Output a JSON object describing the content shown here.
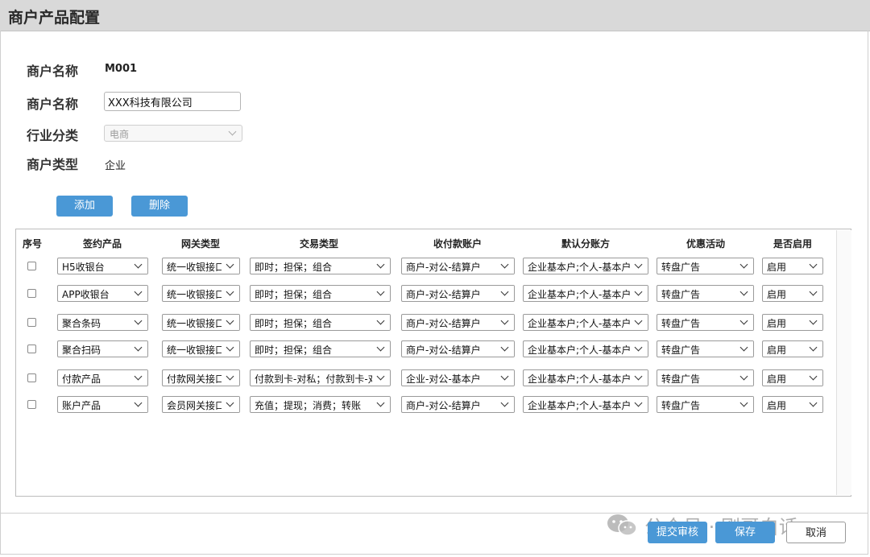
{
  "page_title": "商户产品配置",
  "form": {
    "merchant_id_label": "商户名称",
    "merchant_id_value": "M001",
    "merchant_name_label": "商户名称",
    "merchant_name_value": "XXX科技有限公司",
    "industry_label": "行业分类",
    "industry_value": "电商",
    "merchant_type_label": "商户类型",
    "merchant_type_value": "企业"
  },
  "toolbar": {
    "add_label": "添加",
    "delete_label": "删除"
  },
  "table": {
    "headers": [
      "序号",
      "签约产品",
      "网关类型",
      "交易类型",
      "收付款账户",
      "默认分账方",
      "优惠活动",
      "是否启用"
    ],
    "rows": [
      [
        "H5收银台",
        "统一收银接口",
        "即时；担保；组合",
        "商户-对公-结算户",
        "企业基本户;个人-基本户",
        "转盘广告",
        "启用"
      ],
      [
        "APP收银台",
        "统一收银接口",
        "即时；担保；组合",
        "商户-对公-结算户",
        "企业基本户;个人-基本户",
        "转盘广告",
        "启用"
      ],
      [
        "聚合条码",
        "统一收银接口",
        "即时；担保；组合",
        "商户-对公-结算户",
        "企业基本户;个人-基本户",
        "转盘广告",
        "启用"
      ],
      [
        "聚合扫码",
        "统一收银接口",
        "即时；担保；组合",
        "商户-对公-结算户",
        "企业基本户;个人-基本户",
        "转盘广告",
        "启用"
      ],
      [
        "付款产品",
        "付款网关接口",
        "付款到卡-对私；付款到卡-对公",
        "企业-对公-基本户",
        "企业基本户;个人-基本户",
        "转盘广告",
        "启用"
      ],
      [
        "账户产品",
        "会员网关接口",
        "充值；提现；消费；转账",
        "商户-对公-结算户",
        "企业基本户;个人-基本户",
        "转盘广告",
        "启用"
      ]
    ]
  },
  "footer": {
    "submit_label": "提交审核",
    "save_label": "保存",
    "cancel_label": "取消"
  },
  "watermark": "公众号 · 刚哥白话",
  "colors": {
    "accent": "#4a98d6",
    "titlebar": "#d9d9d9"
  }
}
